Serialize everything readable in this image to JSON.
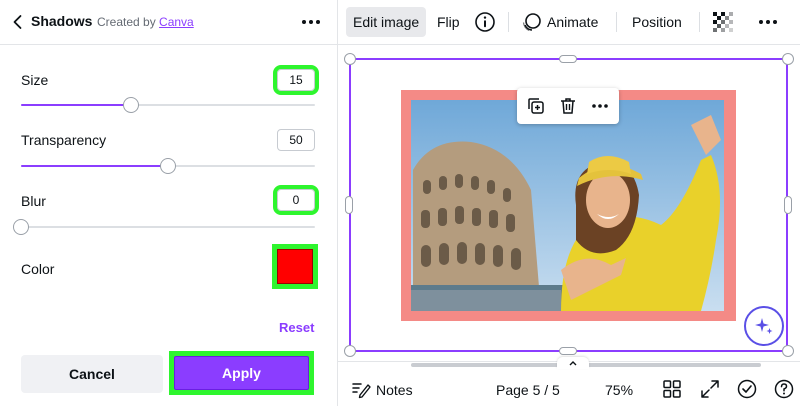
{
  "panel": {
    "title": "Shadows",
    "created_by_prefix": "Created by",
    "created_by_link": "Canva",
    "controls": {
      "size": {
        "label": "Size",
        "value": "15",
        "slider_fraction": 0.375
      },
      "transparency": {
        "label": "Transparency",
        "value": "50",
        "slider_fraction": 0.5
      },
      "blur": {
        "label": "Blur",
        "value": "0",
        "slider_fraction": 0.0
      },
      "color": {
        "label": "Color",
        "value_hex": "#ff0000"
      }
    },
    "reset_label": "Reset",
    "cancel_label": "Cancel",
    "apply_label": "Apply"
  },
  "toolbar": {
    "edit_image_label": "Edit image",
    "flip_label": "Flip",
    "animate_label": "Animate",
    "position_label": "Position"
  },
  "bottom_bar": {
    "notes_label": "Notes",
    "page_indicator": "Page 5 / 5",
    "zoom": "75%"
  },
  "colors": {
    "accent": "#8b3dff",
    "highlight": "#2ef52e",
    "frame": "#f48a86",
    "shadow_color": "#ff0000"
  },
  "icons": [
    "back-chevron-icon",
    "more-dots-icon",
    "info-icon",
    "animate-icon",
    "transparency-checker-icon",
    "duplicate-icon",
    "trash-icon",
    "sparkle-icon",
    "notes-icon",
    "grid-view-icon",
    "fullscreen-icon",
    "check-circle-icon",
    "help-icon",
    "chevron-up-icon"
  ]
}
